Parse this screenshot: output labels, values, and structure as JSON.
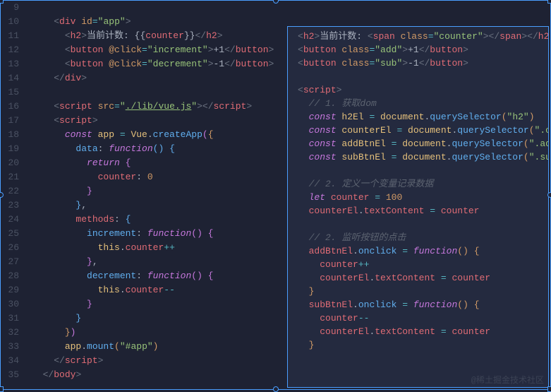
{
  "gutter": [
    "9",
    "10",
    "11",
    "12",
    "13",
    "14",
    "15",
    "16",
    "17",
    "18",
    "19",
    "20",
    "21",
    "22",
    "23",
    "24",
    "25",
    "26",
    "27",
    "28",
    "29",
    "30",
    "31",
    "32",
    "33",
    "34",
    "35"
  ],
  "L": {
    "10a": "    ",
    "10b": "<",
    "10c": "div ",
    "10d": "id",
    "10e": "=",
    "10f": "\"app\"",
    "10g": ">",
    "11a": "      ",
    "11b": "<",
    "11c": "h2",
    "11d": ">",
    "11e": "当前计数: ",
    "11f": "{{",
    "11g": "counter",
    "11h": "}}",
    "11i": "</",
    "11j": "h2",
    "11k": ">",
    "12a": "      ",
    "12b": "<",
    "12c": "button ",
    "12d": "@click",
    "12e": "=",
    "12f": "\"increment\"",
    "12g": ">",
    "12h": "+1",
    "12i": "</",
    "12j": "button",
    "12k": ">",
    "13a": "      ",
    "13b": "<",
    "13c": "button ",
    "13d": "@click",
    "13e": "=",
    "13f": "\"decrement\"",
    "13g": ">",
    "13h": "-1",
    "13i": "</",
    "13j": "button",
    "13k": ">",
    "14a": "    ",
    "14b": "</",
    "14c": "div",
    "14d": ">",
    "16a": "    ",
    "16b": "<",
    "16c": "script ",
    "16d": "src",
    "16e": "=",
    "16f": "\"",
    "16g": "./lib/vue.js",
    "16h": "\"",
    "16i": ">",
    "16j": "</",
    "16k": "script",
    "16l": ">",
    "17a": "    ",
    "17b": "<",
    "17c": "script",
    "17d": ">",
    "18a": "      ",
    "18b": "const ",
    "18c": "app",
    "18d": " = ",
    "18e": "Vue",
    "18f": ".",
    "18g": "createApp",
    "18h": "(",
    "18i": "{",
    "19a": "        ",
    "19b": "data",
    "19c": ": ",
    "19d": "function",
    "19e": "() ",
    "19f": "{",
    "20a": "          ",
    "20b": "return ",
    "20c": "{",
    "21a": "            ",
    "21b": "counter",
    "21c": ": ",
    "21d": "0",
    "22a": "          ",
    "22b": "}",
    "23a": "        ",
    "23b": "}",
    "23c": ",",
    "24a": "        ",
    "24b": "methods",
    "24c": ": ",
    "24d": "{",
    "25a": "          ",
    "25b": "increment",
    "25c": ": ",
    "25d": "function",
    "25e": "() ",
    "25f": "{",
    "26a": "            ",
    "26b": "this",
    "26c": ".",
    "26d": "counter",
    "26e": "++",
    "27a": "          ",
    "27b": "}",
    "27c": ",",
    "28a": "          ",
    "28b": "decrement",
    "28c": ": ",
    "28d": "function",
    "28e": "() ",
    "28f": "{",
    "29a": "            ",
    "29b": "this",
    "29c": ".",
    "29d": "counter",
    "29e": "--",
    "30a": "          ",
    "30b": "}",
    "31a": "        ",
    "31b": "}",
    "32a": "      ",
    "32b": "}",
    "32c": ")",
    "33a": "      ",
    "33b": "app",
    "33c": ".",
    "33d": "mount",
    "33e": "(",
    "33f": "\"#app\"",
    "33g": ")",
    "34a": "    ",
    "34b": "</",
    "34c": "script",
    "34d": ">",
    "35a": "  ",
    "35b": "</",
    "35c": "body",
    "35d": ">"
  },
  "R": {
    "1a": "<",
    "1b": "h2",
    "1c": ">",
    "1d": "当前计数: ",
    "1e": "<",
    "1f": "span ",
    "1g": "class",
    "1h": "=",
    "1i": "\"counter\"",
    "1j": ">",
    "1k": "</",
    "1l": "span",
    "1m": ">",
    "1n": "</",
    "1o": "h2",
    "1p": ">",
    "2a": "<",
    "2b": "button ",
    "2c": "class",
    "2d": "=",
    "2e": "\"add\"",
    "2f": ">",
    "2g": "+1",
    "2h": "</",
    "2i": "button",
    "2j": ">",
    "3a": "<",
    "3b": "button ",
    "3c": "class",
    "3d": "=",
    "3e": "\"sub\"",
    "3f": ">",
    "3g": "-1",
    "3h": "</",
    "3i": "button",
    "3j": ">",
    "5a": "<",
    "5b": "script",
    "5c": ">",
    "6": "  // 1. 获取dom",
    "7a": "  ",
    "7b": "const ",
    "7c": "h2El",
    "7d": " = ",
    "7e": "document",
    "7f": ".",
    "7g": "querySelector",
    "7h": "(",
    "7i": "\"h2\"",
    "7j": ")",
    "8a": "  ",
    "8b": "const ",
    "8c": "counterEl",
    "8d": " = ",
    "8e": "document",
    "8f": ".",
    "8g": "querySelector",
    "8h": "(",
    "8i": "\".counte",
    "9a": "  ",
    "9b": "const ",
    "9c": "addBtnEl",
    "9d": " = ",
    "9e": "document",
    "9f": ".",
    "9g": "querySelector",
    "9h": "(",
    "9i": "\".add\"",
    "9j": ")",
    "10a": "  ",
    "10b": "const ",
    "10c": "subBtnEl",
    "10d": " = ",
    "10e": "document",
    "10f": ".",
    "10g": "querySelector",
    "10h": "(",
    "10i": "\".sub\"",
    "10j": ")",
    "12": "  // 2. 定义一个变量记录数据",
    "13a": "  ",
    "13b": "let ",
    "13c": "counter",
    "13d": " = ",
    "13e": "100",
    "14a": "  ",
    "14b": "counterEl",
    "14c": ".",
    "14d": "textContent",
    "14e": " = ",
    "14f": "counter",
    "16": "  // 2. 监听按钮的点击",
    "17a": "  ",
    "17b": "addBtnEl",
    "17c": ".",
    "17d": "onclick",
    "17e": " = ",
    "17f": "function",
    "17g": "() ",
    "17h": "{",
    "18a": "    ",
    "18b": "counter",
    "18c": "++",
    "19a": "    ",
    "19b": "counterEl",
    "19c": ".",
    "19d": "textContent",
    "19e": " = ",
    "19f": "counter",
    "20a": "  ",
    "20b": "}",
    "21a": "  ",
    "21b": "subBtnEl",
    "21c": ".",
    "21d": "onclick",
    "21e": " = ",
    "21f": "function",
    "21g": "() ",
    "21h": "{",
    "22a": "    ",
    "22b": "counter",
    "22c": "--",
    "23a": "    ",
    "23b": "counterEl",
    "23c": ".",
    "23d": "textContent",
    "23e": " = ",
    "23f": "counter",
    "24a": "  ",
    "24b": "}"
  },
  "watermark": "@稀土掘金技术社区"
}
